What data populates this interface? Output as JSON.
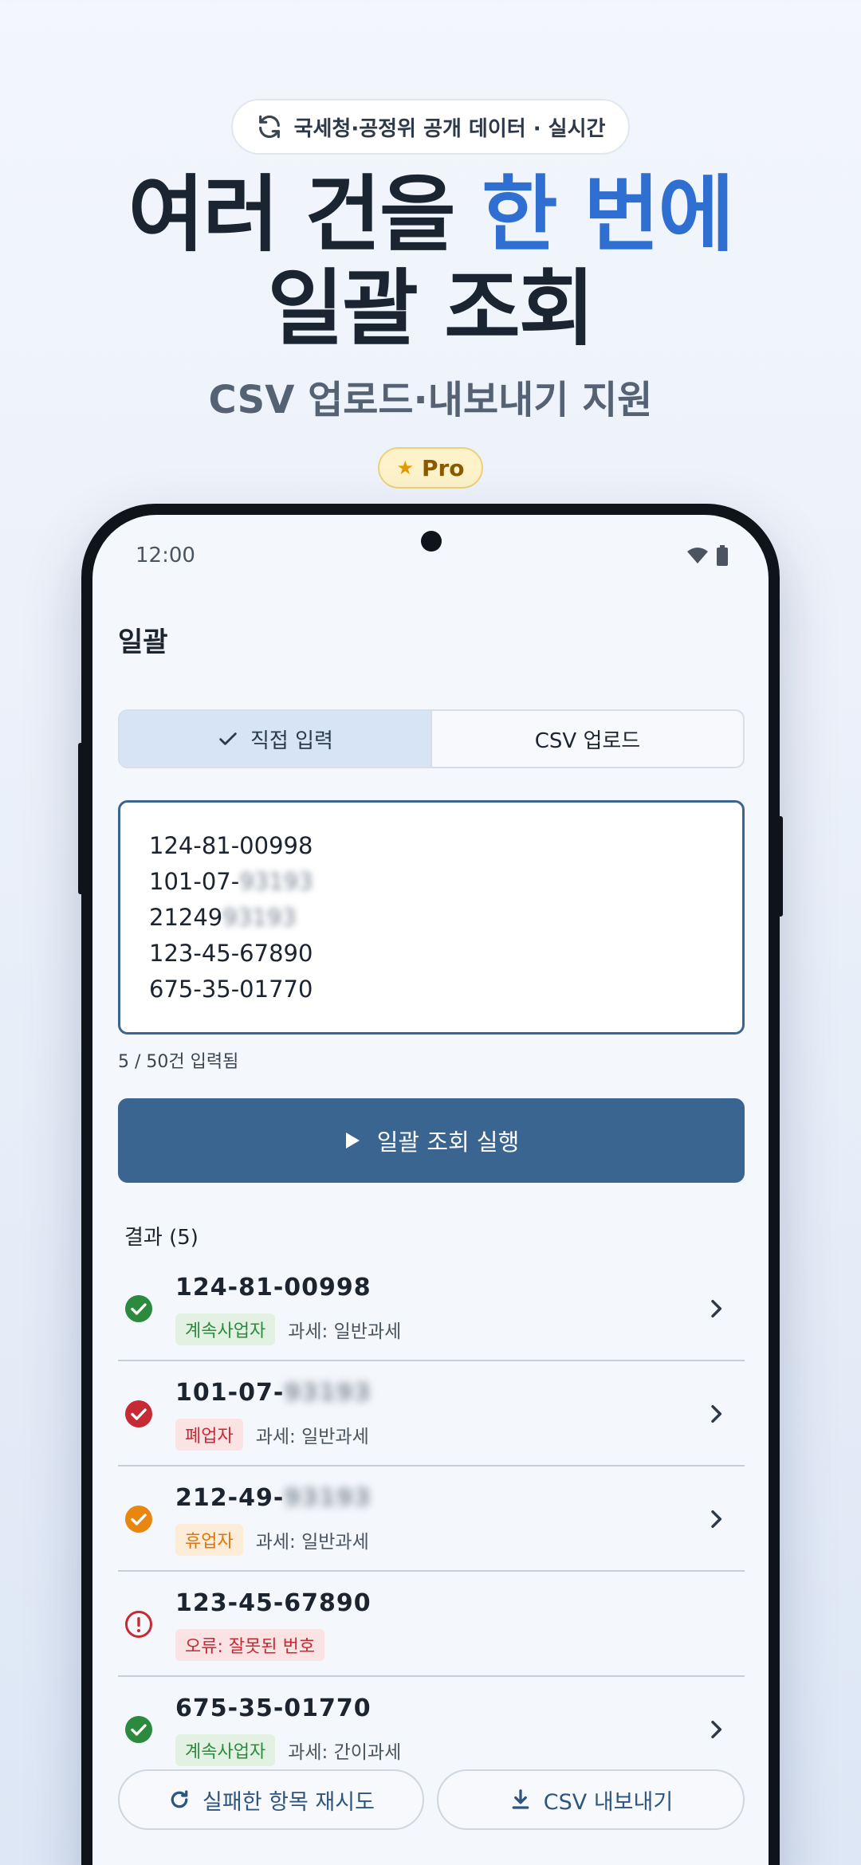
{
  "promo": {
    "badge_text": "국세청·공정위 공개 데이터 · 실시간",
    "headline_line1_part1": "여러 건을 ",
    "headline_line1_accent": "한 번에",
    "headline_line2": "일괄 조회",
    "subhead": "CSV 업로드·내보내기 지원",
    "pro_label": "Pro"
  },
  "status_bar": {
    "time": "12:00"
  },
  "app_bar": {
    "title": "일괄"
  },
  "segmented": {
    "direct_label": "직접 입력",
    "csv_label": "CSV 업로드"
  },
  "input": {
    "lines": [
      {
        "visible": "124-81-00998",
        "masked": ""
      },
      {
        "visible": "101-07-",
        "masked": "93193"
      },
      {
        "visible": "21249",
        "masked": "93193"
      },
      {
        "visible": "123-45-67890",
        "masked": ""
      },
      {
        "visible": "675-35-01770",
        "masked": ""
      }
    ],
    "counter": "5 / 50건 입력됨"
  },
  "run_button_label": "일괄 조회 실행",
  "results": {
    "title": "결과 (5)",
    "rows": [
      {
        "id_visible": "124-81-00998",
        "id_masked": "",
        "status": "계속사업자",
        "status_kind": "green",
        "tax": "과세: 일반과세"
      },
      {
        "id_visible": "101-07-",
        "id_masked": "93193",
        "status": "폐업자",
        "status_kind": "red",
        "tax": "과세: 일반과세"
      },
      {
        "id_visible": "212-49-",
        "id_masked": "93193",
        "status": "휴업자",
        "status_kind": "orange",
        "tax": "과세: 일반과세"
      },
      {
        "id_visible": "123-45-67890",
        "id_masked": "",
        "status": "오류: 잘못된 번호",
        "status_kind": "red",
        "tax": ""
      },
      {
        "id_visible": "675-35-01770",
        "id_masked": "",
        "status": "계속사업자",
        "status_kind": "green",
        "tax": "과세: 간이과세"
      }
    ]
  },
  "bottom": {
    "retry_label": "실패한 항목 재시도",
    "export_label": "CSV 내보내기"
  },
  "colors": {
    "accent": "#2f6fd1",
    "primary": "#3a6591",
    "success": "#2b8a3e",
    "error": "#c62a34",
    "warning": "#d97610"
  }
}
